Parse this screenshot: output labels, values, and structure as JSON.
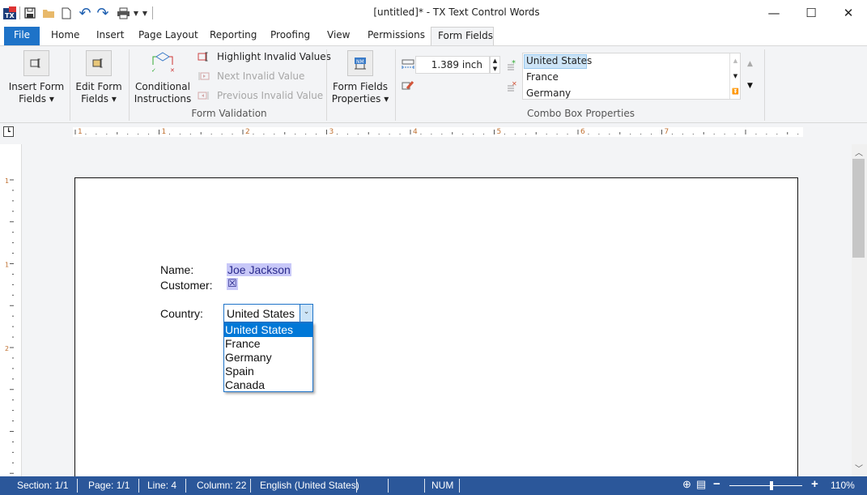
{
  "window": {
    "title": "[untitled]* - TX Text Control Words",
    "app_icon": "tx-app-icon",
    "quick_access": [
      "save-icon",
      "open-folder-icon",
      "new-document-icon",
      "undo-icon",
      "redo-icon",
      "print-icon",
      "dropdown-arrow-icon",
      "customize-dropdown-icon"
    ],
    "controls": {
      "minimize": "—",
      "maximize": "☐",
      "close": "✕"
    }
  },
  "tabs": [
    {
      "label": "File",
      "active": false
    },
    {
      "label": "Home",
      "active": false
    },
    {
      "label": "Insert",
      "active": false
    },
    {
      "label": "Page Layout",
      "active": false
    },
    {
      "label": "Reporting",
      "active": false
    },
    {
      "label": "Proofing",
      "active": false
    },
    {
      "label": "View",
      "active": false
    },
    {
      "label": "Permissions",
      "active": false
    },
    {
      "label": "Form Fields",
      "active": true
    }
  ],
  "ribbon": {
    "insert_form_fields": {
      "line1": "Insert Form",
      "line2": "Fields ▾"
    },
    "edit_form_fields": {
      "line1": "Edit Form",
      "line2": "Fields ▾"
    },
    "conditional_instructions": {
      "line1": "Conditional",
      "line2": "Instructions"
    },
    "highlight_invalid": "Highlight Invalid Values",
    "next_invalid": "Next Invalid Value",
    "previous_invalid": "Previous Invalid Value",
    "form_validation_label": "Form Validation",
    "form_fields_properties": {
      "line1": "Form Fields",
      "line2": "Properties ▾"
    },
    "width_value": "1.389  inch",
    "combo_items": [
      "United States",
      "France",
      "Germany"
    ],
    "combo_selected": "United States",
    "combo_box_properties_label": "Combo Box Properties"
  },
  "ruler": {
    "h_labels": [
      "1",
      "1",
      "2",
      "3",
      "4",
      "5",
      "6",
      "7"
    ],
    "v_labels": [
      "1",
      "1",
      "2"
    ]
  },
  "document": {
    "name_label": "Name:",
    "name_value": "Joe Jackson",
    "customer_label": "Customer:",
    "customer_checkbox": "☒",
    "country_label": "Country:",
    "country_value": "United States",
    "country_options": [
      "United States",
      "France",
      "Germany",
      "Spain",
      "Canada"
    ],
    "country_selected_index": 0,
    "highlight_color": "#c8c8f8",
    "selection_color": "#0078d7"
  },
  "statusbar": {
    "section": "Section: 1/1",
    "page": "Page: 1/1",
    "line": "Line: 4",
    "column": "Column: 22",
    "language": "English (United States)",
    "num": "NUM",
    "zoom": "110%",
    "zoom_fraction": 0.55
  }
}
